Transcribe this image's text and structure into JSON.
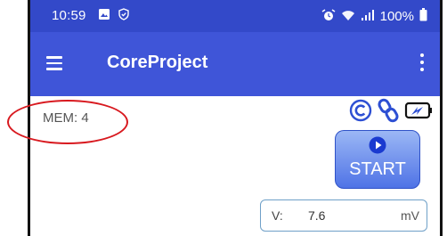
{
  "status_bar": {
    "time": "10:59",
    "battery": "100%",
    "left_icons": [
      "gallery-icon",
      "shield-icon"
    ],
    "right_icons": [
      "alarm-icon",
      "wifi-icon",
      "signal-icon",
      "battery-icon"
    ]
  },
  "app_bar": {
    "title": "CoreProject",
    "menu_icon": "menu-icon",
    "overflow_icon": "more-vert-icon"
  },
  "mem": {
    "label": "MEM:  4"
  },
  "indicator_icons": [
    "copyright-icon",
    "link-icon",
    "battery-charging-icon"
  ],
  "start_button": {
    "label": "START",
    "icon": "play-icon"
  },
  "voltage": {
    "label": "V:",
    "value": "7.6",
    "unit": "mV"
  },
  "colors": {
    "status_bar": "#3349c9",
    "app_bar": "#3f55d8",
    "accent": "#2d4fd3",
    "annotation": "#d8191f"
  }
}
